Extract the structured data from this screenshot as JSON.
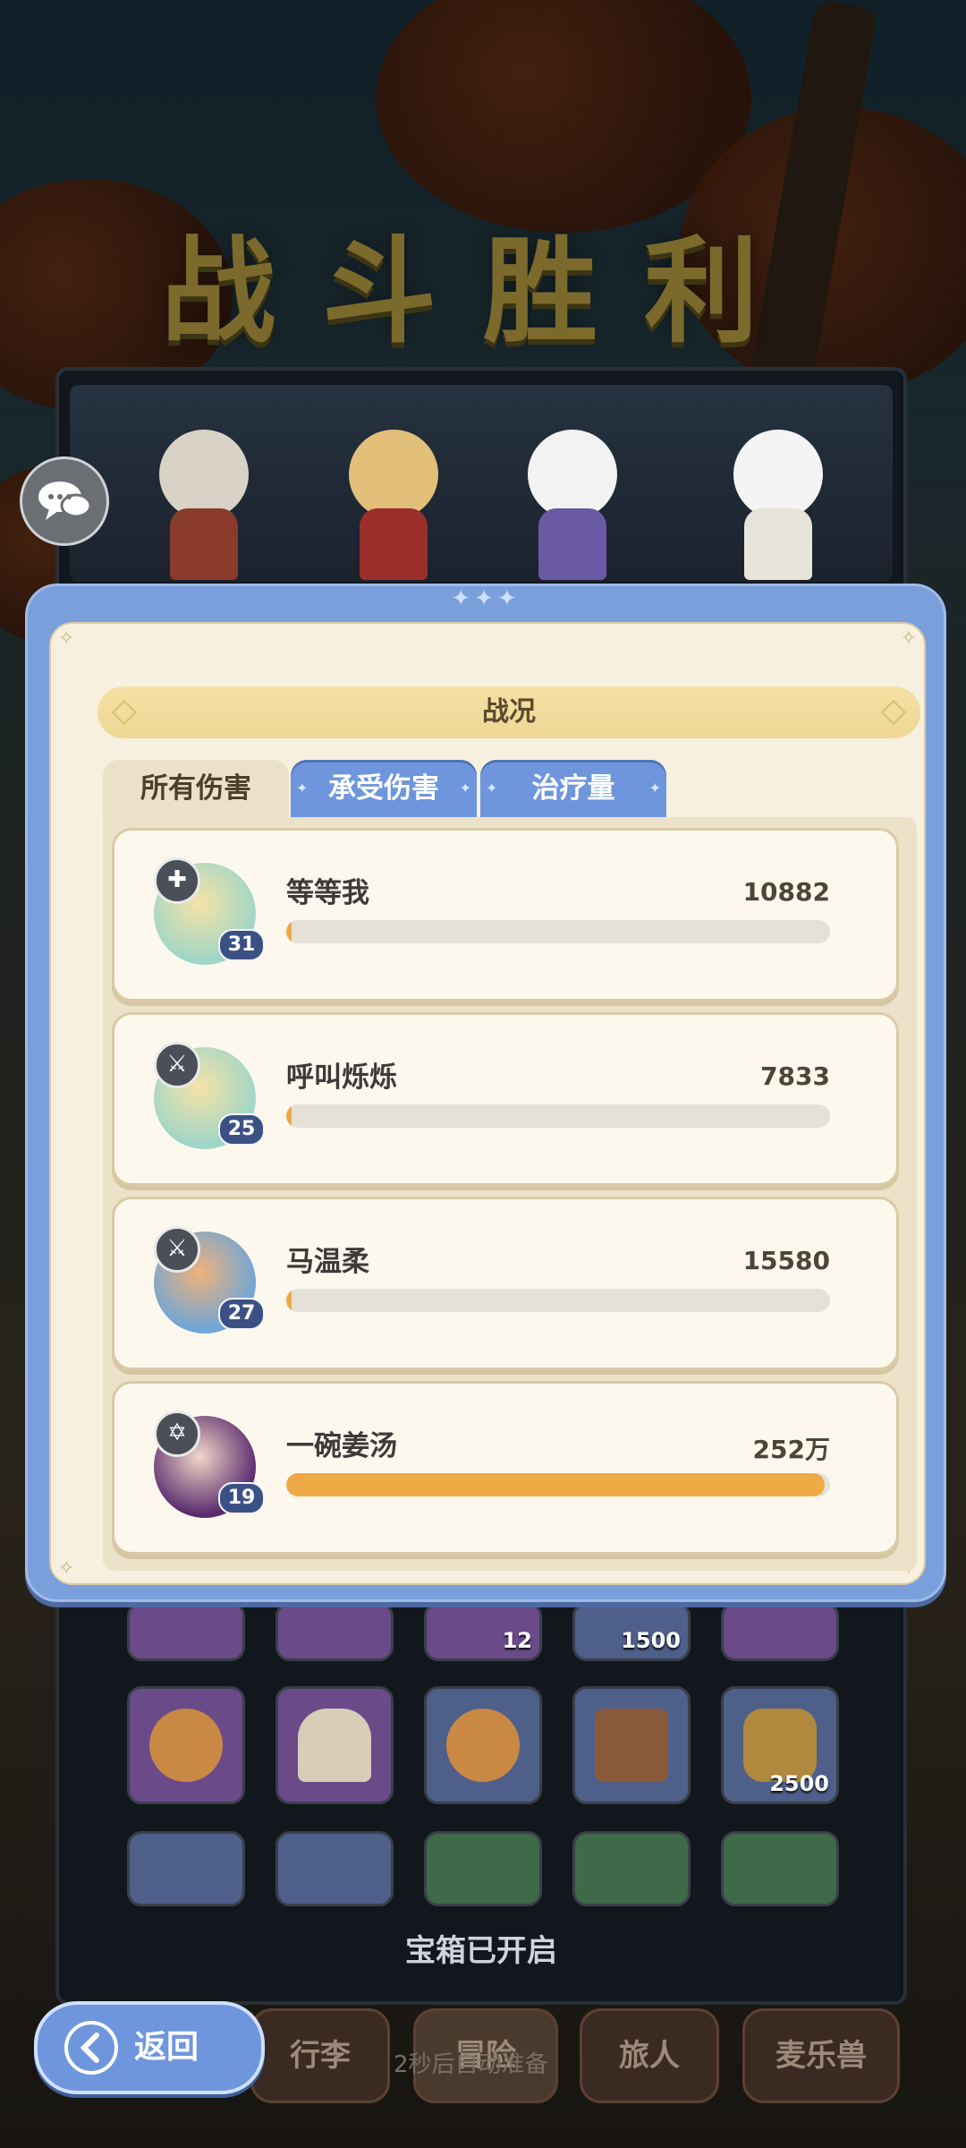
{
  "header": {
    "title": "战斗胜利"
  },
  "dialog": {
    "title": "战况",
    "tabs": [
      {
        "label": "所有伤害",
        "active": true
      },
      {
        "label": "承受伤害",
        "active": false
      },
      {
        "label": "治疗量",
        "active": false
      }
    ],
    "rows": [
      {
        "name": "等等我",
        "value": "10882",
        "level": "31",
        "role_icon": "cross-role-icon",
        "bar_fraction": 0.004
      },
      {
        "name": "呼叫烁烁",
        "value": "7833",
        "level": "25",
        "role_icon": "sword-role-icon",
        "bar_fraction": 0.003
      },
      {
        "name": "马温柔",
        "value": "15580",
        "level": "27",
        "role_icon": "sword-role-icon",
        "bar_fraction": 0.006
      },
      {
        "name": "一碗姜汤",
        "value": "252万",
        "level": "19",
        "role_icon": "star-role-icon",
        "bar_fraction": 0.99
      }
    ]
  },
  "loot": {
    "quantities": [
      "12",
      "1500",
      "2500"
    ],
    "status": "宝箱已开启"
  },
  "bottom_nav": {
    "tabs": [
      "行李",
      "冒险",
      "旅人",
      "麦乐兽"
    ],
    "countdown": "2秒后自动准备",
    "back_label": "返回"
  },
  "colors": {
    "accent_blue": "#6f96dd",
    "bar_fill": "#efaa48",
    "panel_cream": "#f7f0df"
  }
}
